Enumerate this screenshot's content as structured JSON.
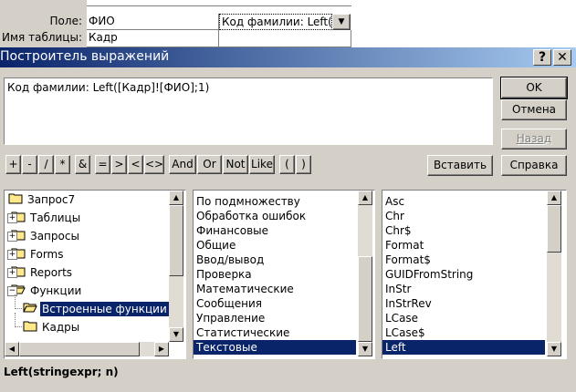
{
  "background_grid": {
    "field_label": "Поле:",
    "table_label": "Имя таблицы:",
    "col1_field": "ФИО",
    "col1_table": "Кадр",
    "col2_field": "Код фамилии: Left([I"
  },
  "dialog": {
    "title": "Построитель выражений",
    "help_button": "?",
    "close_button": "✕"
  },
  "expression": "Код фамилии: Left([Кадр]![ФИО];1)",
  "buttons": {
    "ok": "OK",
    "cancel": "Отмена",
    "back": "Назад",
    "insert": "Вставить",
    "help": "Справка"
  },
  "operators": [
    "+",
    "-",
    "/",
    "*",
    "&",
    "=",
    ">",
    "<",
    "<>",
    "And",
    "Or",
    "Not",
    "Like",
    "(",
    ")"
  ],
  "tree": [
    {
      "label": "Запрос7",
      "expander": "none"
    },
    {
      "label": "Таблицы",
      "expander": "+"
    },
    {
      "label": "Запросы",
      "expander": "+"
    },
    {
      "label": "Forms",
      "expander": "+"
    },
    {
      "label": "Reports",
      "expander": "+"
    },
    {
      "label": "Функции",
      "expander": "-"
    },
    {
      "label": "Встроенные функции",
      "expander": "child",
      "selected": true
    },
    {
      "label": "Кадры",
      "expander": "child"
    }
  ],
  "categories": [
    "По подмножеству",
    "Обработка ошибок",
    "Финансовые",
    "Общие",
    "Ввод/вывод",
    "Проверка",
    "Математические",
    "Сообщения",
    "Управление",
    "Статистические",
    "Текстовые"
  ],
  "selected_category": "Текстовые",
  "functions": [
    "Asc",
    "Chr",
    "Chr$",
    "Format",
    "Format$",
    "GUIDFromString",
    "InStr",
    "InStrRev",
    "LCase",
    "LCase$",
    "Left"
  ],
  "selected_function": "Left",
  "syntax": "Left(stringexpr; n)",
  "colors": {
    "title_start": "#0a246a",
    "title_end": "#a6caf0",
    "selection": "#0a246a",
    "face": "#d4d0c8"
  }
}
